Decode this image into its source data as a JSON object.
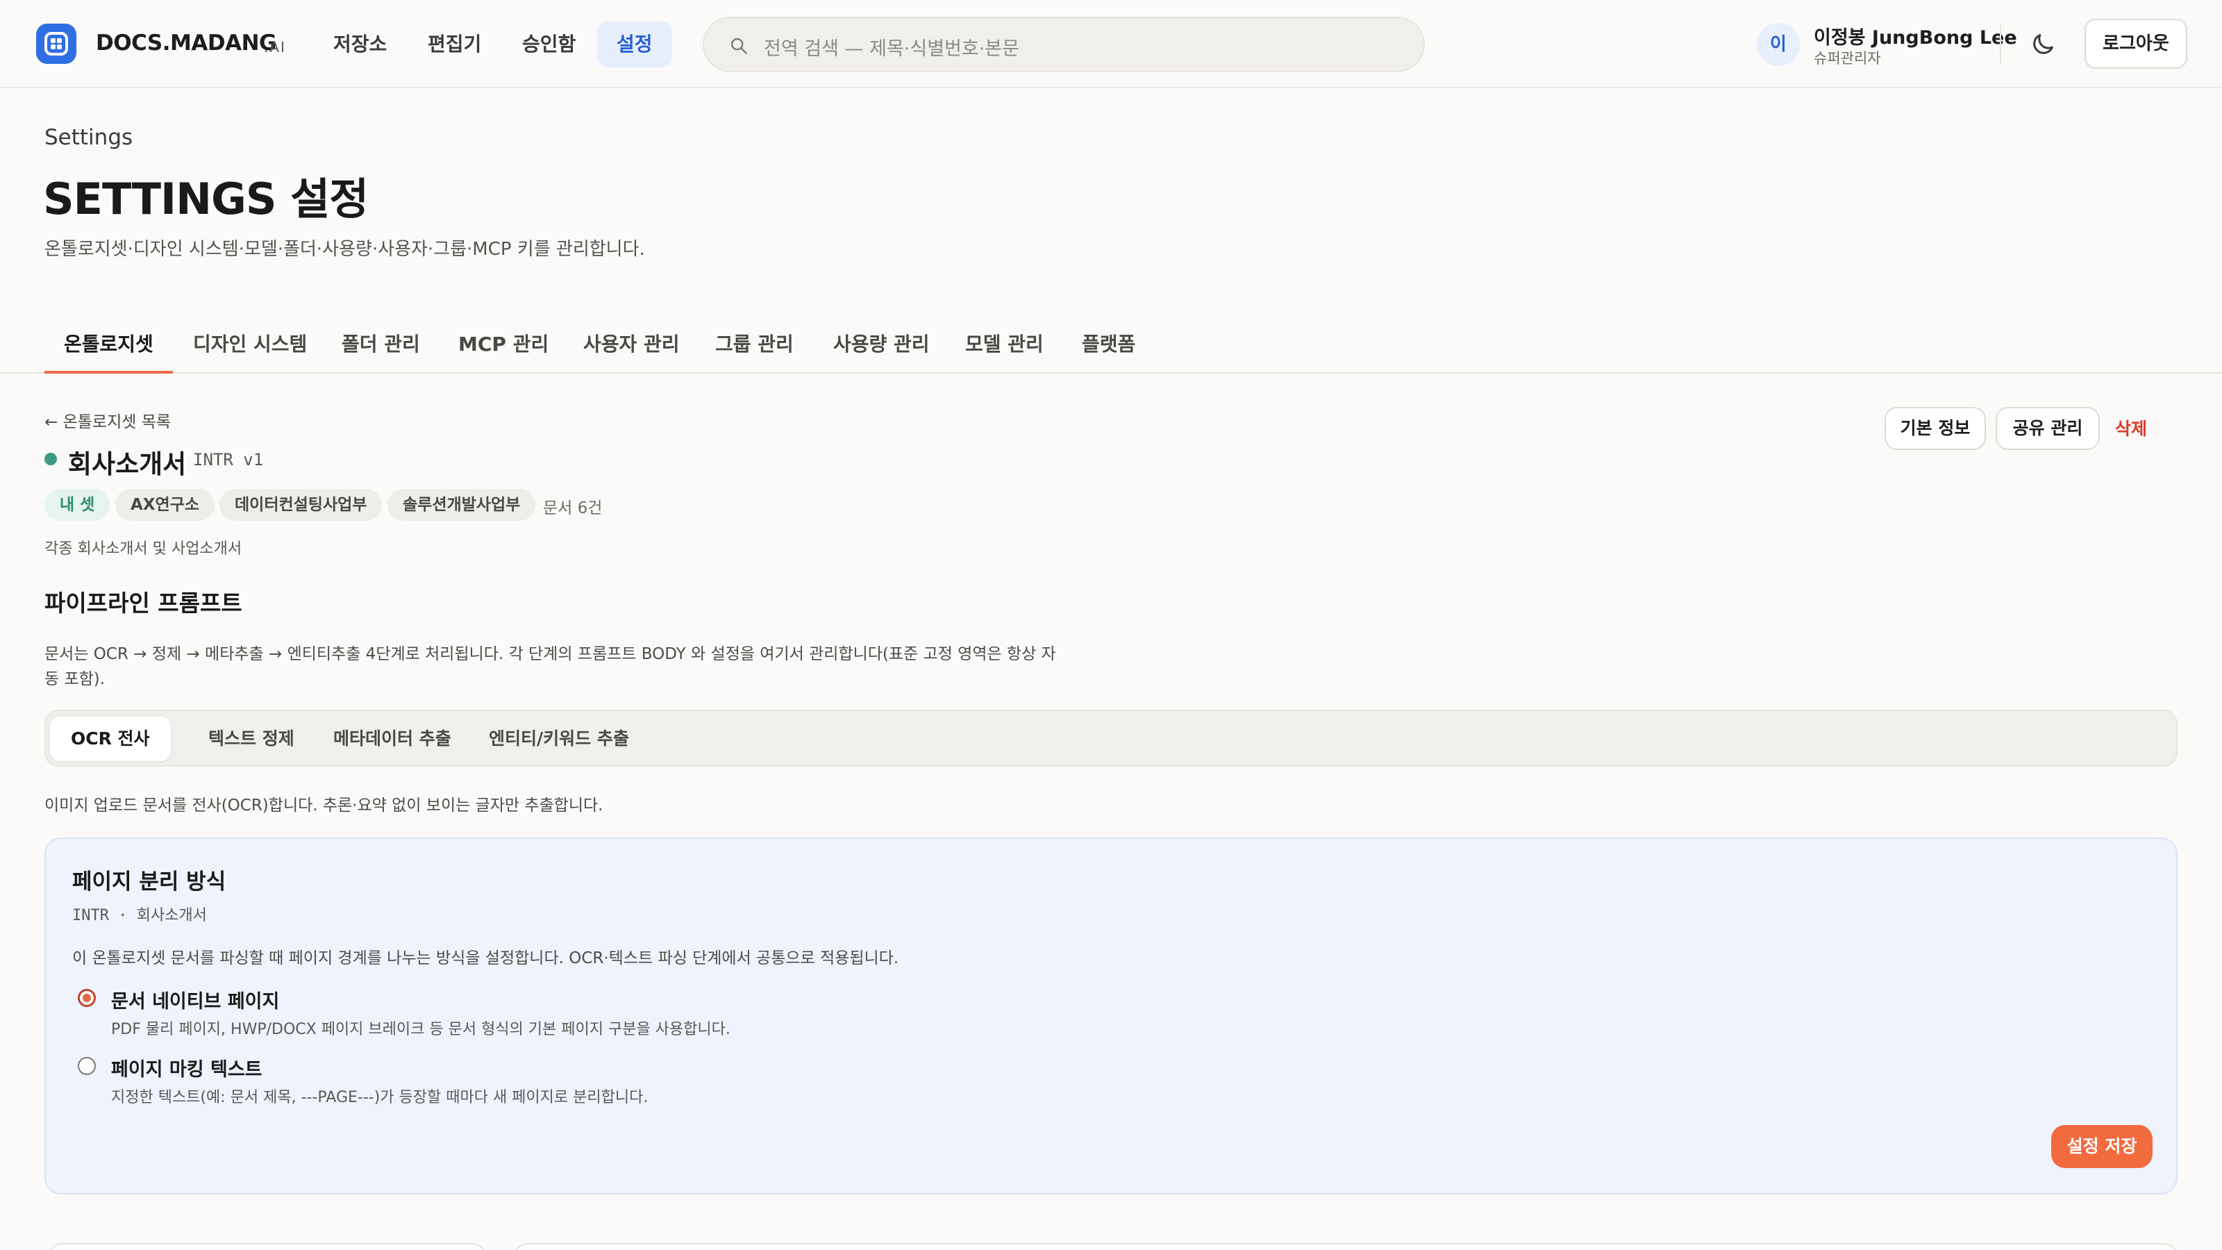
{
  "brand": {
    "name": "DOCS.MADANG",
    "suffix": ".AI"
  },
  "nav": {
    "items": [
      {
        "label": "저장소"
      },
      {
        "label": "편집기"
      },
      {
        "label": "승인함"
      },
      {
        "label": "설정",
        "active": true
      }
    ]
  },
  "search": {
    "placeholder": "전역 검색 — 제목·식별번호·본문"
  },
  "user": {
    "initial": "이",
    "name": "이정봉 JungBong Lee",
    "role": "슈퍼관리자"
  },
  "header": {
    "logout_label": "로그아웃",
    "eyebrow": "Settings",
    "title": "SETTINGS 설정",
    "description": "온톨로지셋·디자인 시스템·모델·폴더·사용량·사용자·그룹·MCP 키를 관리합니다."
  },
  "tabs": [
    {
      "label": "온톨로지셋",
      "active": true
    },
    {
      "label": "디자인 시스템"
    },
    {
      "label": "폴더 관리"
    },
    {
      "label": "MCP 관리"
    },
    {
      "label": "사용자 관리"
    },
    {
      "label": "그룹 관리"
    },
    {
      "label": "사용량 관리"
    },
    {
      "label": "모델 관리"
    },
    {
      "label": "플랫폼"
    }
  ],
  "ontology": {
    "back_label": "← 온톨로지셋 목록",
    "name": "회사소개서",
    "code": "INTR v1",
    "status_color": "#3f9a82",
    "chips": [
      {
        "label": "내 셋"
      },
      {
        "label": "AX연구소"
      },
      {
        "label": "데이터컨설팅사업부"
      },
      {
        "label": "솔루션개발사업부"
      }
    ],
    "doc_count": "문서 6건",
    "description": "각종 회사소개서 및 사업소개서",
    "actions": {
      "info_label": "기본 정보",
      "share_label": "공유 관리",
      "delete_label": "삭제"
    }
  },
  "pipeline": {
    "title": "파이프라인 프롬프트",
    "description": "문서는 OCR → 정제 → 메타추출 → 엔티티추출 4단계로 처리됩니다. 각 단계의 프롬프트 BODY 와 설정을 여기서 관리합니다(표준 고정 영역은 항상 자동 포함).",
    "stages": [
      {
        "label": "OCR 전사",
        "active": true
      },
      {
        "label": "텍스트 정제"
      },
      {
        "label": "메타데이터 추출"
      },
      {
        "label": "엔티티/키워드 추출"
      }
    ],
    "stage_description": "이미지 업로드 문서를 전사(OCR)합니다. 추론·요약 없이 보이는 글자만 추출합니다."
  },
  "page_split": {
    "title": "페이지 분리 방식",
    "subtitle": "INTR · 회사소개서",
    "description": "이 온톨로지셋 문서를 파싱할 때 페이지 경계를 나누는 방식을 설정합니다. OCR·텍스트 파싱 단계에서 공통으로 적용됩니다.",
    "options": [
      {
        "label": "문서 네이티브 페이지",
        "description": "PDF 물리 페이지, HWP/DOCX 페이지 브레이크 등 문서 형식의 기본 페이지 구분을 사용합니다.",
        "selected": true
      },
      {
        "label": "페이지 마킹 텍스트",
        "description": "지정한 텍스트(예: 문서 제목, ---PAGE---)가 등장할 때마다 새 페이지로 분리합니다.",
        "selected": false
      }
    ],
    "save_label": "설정 저장"
  },
  "colors": {
    "accent": "#f26b3f",
    "brand": "#2f6fe4",
    "nav_active": "#2760d6",
    "danger": "#d83b2b",
    "panel_bg": "#eef3fd"
  }
}
